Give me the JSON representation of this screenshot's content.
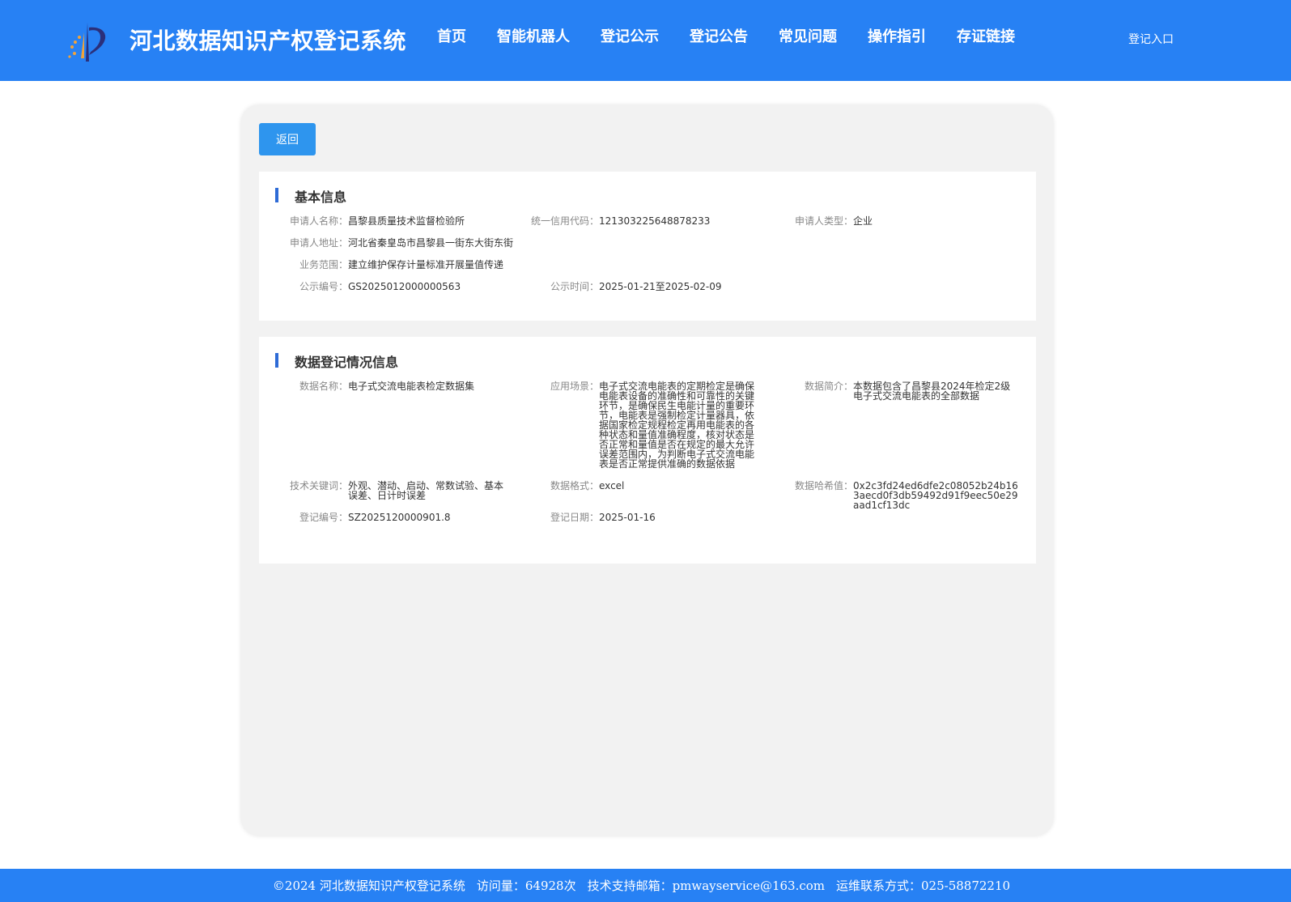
{
  "header": {
    "site_title": "河北数据知识产权登记系统",
    "nav": [
      "首页",
      "智能机器人",
      "登记公示",
      "登记公告",
      "常见问题",
      "操作指引",
      "存证链接"
    ],
    "login": "登记入口",
    "logo_icon": "ip-logo-icon"
  },
  "actions": {
    "back_label": "返回"
  },
  "basic_info": {
    "title": "基本信息",
    "applicant_name_label": "申请人名称：",
    "applicant_name": "昌黎县质量技术监督检验所",
    "credit_code_label": "统一信用代码：",
    "credit_code": "121303225648878233",
    "applicant_type_label": "申请人类型：",
    "applicant_type": "企业",
    "address_label": "申请人地址：",
    "address": "河北省秦皇岛市昌黎县一街东大街东街",
    "scope_label": "业务范围：",
    "scope": "建立维护保存计量标准开展量值传递",
    "notice_no_label": "公示编号：",
    "notice_no": "GS2025012000000563",
    "notice_time_label": "公示时间：",
    "notice_time": "2025-01-21至2025-02-09"
  },
  "registration_info": {
    "title": "数据登记情况信息",
    "data_name_label": "数据名称：",
    "data_name": "电子式交流电能表检定数据集",
    "scenario_label": "应用场景：",
    "scenario": "电子式交流电能表的定期检定是确保电能表设备的准确性和可靠性的关键环节，是确保民生电能计量的重要环节，电能表是强制检定计量器具，依据国家检定规程检定再用电能表的各种状态和量值准确程度，核对状态是否正常和量值是否在规定的最大允许误差范围内，为判断电子式交流电能表是否正常提供准确的数据依据",
    "summary_label": "数据简介：",
    "summary": "本数据包含了昌黎县2024年检定2级电子式交流电能表的全部数据",
    "keywords_label": "技术关键词：",
    "keywords": "外观、潜动、启动、常数试验、基本误差、日计时误差",
    "format_label": "数据格式：",
    "format": "excel",
    "hash_label": "数据哈希值：",
    "hash": "0x2c3fd24ed6dfe2c08052b24b163aecd0f3db59492d91f9eec50e29aad1cf13dc",
    "reg_no_label": "登记编号：",
    "reg_no": "SZ2025120000901.8",
    "reg_date_label": "登记日期：",
    "reg_date": "2025-01-16"
  },
  "footer": {
    "copyright": "©2024 河北数据知识产权登记系统",
    "visits": "访问量：64928次",
    "email": "技术支持邮箱：pmwayservice@163.com",
    "phone": "运维联系方式：025-58872210"
  },
  "colors": {
    "primary": "#2781f4",
    "button": "#2e95ee",
    "panel": "#f2f2f2",
    "accent_bar": "#2e6bd6"
  }
}
